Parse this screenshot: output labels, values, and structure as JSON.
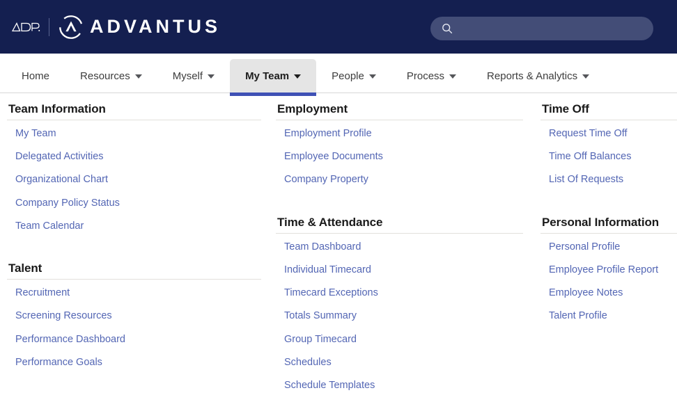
{
  "header": {
    "brand_adp": "ADP",
    "brand_name": "ADVANTUS",
    "adp_icon": "adp-logo-icon",
    "advantus_icon": "advantus-circle-icon",
    "navy": "#141f50",
    "search": {
      "icon": "search-icon",
      "value": "",
      "placeholder": ""
    }
  },
  "nav": {
    "active_color": "#3f51b5",
    "items": [
      {
        "label": "Home",
        "has_caret": false,
        "active": false
      },
      {
        "label": "Resources",
        "has_caret": true,
        "active": false
      },
      {
        "label": "Myself",
        "has_caret": true,
        "active": false
      },
      {
        "label": "My Team",
        "has_caret": true,
        "active": true
      },
      {
        "label": "People",
        "has_caret": true,
        "active": false
      },
      {
        "label": "Process",
        "has_caret": true,
        "active": false
      },
      {
        "label": "Reports & Analytics",
        "has_caret": true,
        "active": false
      }
    ]
  },
  "mega_menu": {
    "link_color": "#5366b4",
    "columns": [
      {
        "sections": [
          {
            "title": "Team Information",
            "links": [
              "My Team",
              "Delegated Activities",
              "Organizational Chart",
              "Company Policy Status",
              "Team Calendar"
            ]
          },
          {
            "title": "Talent",
            "links": [
              "Recruitment",
              "Screening Resources",
              "Performance Dashboard",
              "Performance Goals"
            ]
          }
        ]
      },
      {
        "sections": [
          {
            "title": "Employment",
            "links": [
              "Employment Profile",
              "Employee Documents",
              "Company Property"
            ]
          },
          {
            "title": "Time & Attendance",
            "links": [
              "Team Dashboard",
              "Individual Timecard",
              "Timecard Exceptions",
              "Totals Summary",
              "Group Timecard",
              "Schedules",
              "Schedule Templates"
            ]
          }
        ]
      },
      {
        "sections": [
          {
            "title": "Time Off",
            "links": [
              "Request Time Off",
              "Time Off Balances",
              "List Of Requests"
            ]
          },
          {
            "title": "Personal Information",
            "links": [
              "Personal Profile",
              "Employee Profile Report",
              "Employee Notes",
              "Talent Profile"
            ]
          }
        ]
      }
    ]
  }
}
